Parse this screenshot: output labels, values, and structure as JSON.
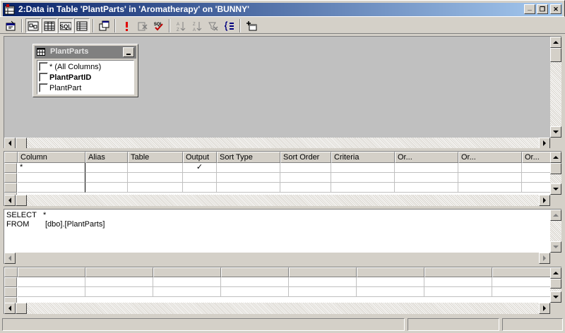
{
  "window": {
    "title": "2:Data in Table 'PlantParts' in 'Aromatherapy' on 'BUNNY'",
    "minimize_glyph": "_",
    "restore_glyph": "❐",
    "close_glyph": "✕"
  },
  "toolbar": {
    "buttons": [
      {
        "icon": "properties-icon"
      },
      {
        "icon": "show-diagram-pane-icon",
        "pressed": true
      },
      {
        "icon": "show-grid-pane-icon",
        "pressed": true
      },
      {
        "icon": "show-sql-pane-icon",
        "label": "SQL",
        "pressed": true
      },
      {
        "icon": "show-results-pane-icon",
        "pressed": true
      },
      {
        "icon": "change-query-type-icon"
      },
      {
        "icon": "run-icon"
      },
      {
        "icon": "clear-results-icon"
      },
      {
        "icon": "verify-sql-icon",
        "label": "SQL"
      },
      {
        "icon": "sort-ascending-icon"
      },
      {
        "icon": "sort-descending-icon"
      },
      {
        "icon": "remove-filter-icon"
      },
      {
        "icon": "group-by-icon"
      },
      {
        "icon": "add-table-icon"
      }
    ]
  },
  "diagram": {
    "table": {
      "name": "PlantParts",
      "columns": [
        {
          "label": "* (All Columns)",
          "bold": false,
          "checked": false
        },
        {
          "label": "PlantPartID",
          "bold": true,
          "checked": false
        },
        {
          "label": "PlantPart",
          "bold": false,
          "checked": false
        }
      ]
    }
  },
  "grid": {
    "headers": [
      "Column",
      "Alias",
      "Table",
      "Output",
      "Sort Type",
      "Sort Order",
      "Criteria",
      "Or...",
      "Or...",
      "Or..."
    ],
    "rows": [
      {
        "column": "*",
        "alias": "",
        "table": "",
        "output": "✓",
        "sort_type": "",
        "sort_order": "",
        "criteria": ""
      },
      {
        "column": "",
        "alias": "",
        "table": "",
        "output": "",
        "sort_type": "",
        "sort_order": "",
        "criteria": ""
      },
      {
        "column": "",
        "alias": "",
        "table": "",
        "output": "",
        "sort_type": "",
        "sort_order": "",
        "criteria": ""
      }
    ]
  },
  "sql": {
    "line1_keyword": "SELECT",
    "line1_value": "*",
    "line2_keyword": "FROM",
    "line2_value": "[dbo].[PlantParts]"
  },
  "results": {
    "rows": 3
  },
  "status": {
    "panels": [
      "",
      "",
      ""
    ]
  }
}
